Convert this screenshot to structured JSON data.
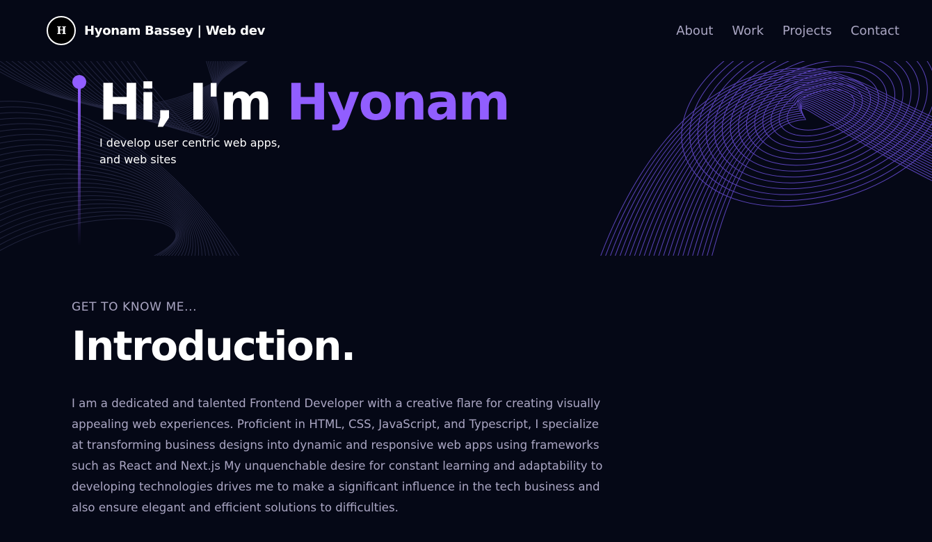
{
  "nav": {
    "logo_text": "H",
    "brand_name": "Hyonam Bassey",
    "brand_separator": "|",
    "brand_role": "Web dev",
    "links": [
      {
        "label": "About"
      },
      {
        "label": "Work"
      },
      {
        "label": "Projects"
      },
      {
        "label": "Contact"
      }
    ]
  },
  "hero": {
    "greeting": "Hi, I'm ",
    "name": "Hyonam",
    "subtitle_line1": "I develop user centric web apps,",
    "subtitle_line2": "and web sites"
  },
  "intro": {
    "eyebrow": "Get to know me...",
    "title": "Introduction.",
    "body": "I am a dedicated and talented Frontend Developer with a creative flare for creating visually appealing web experiences. Proficient in HTML, CSS, JavaScript, and Typescript, I specialize at transforming business designs into dynamic and responsive web apps using frameworks such as React and Next.js My unquenchable desire for constant learning and adaptability to developing technologies drives me to make a significant influence in the tech business and also ensure elegant and efficient solutions to difficulties."
  },
  "colors": {
    "background": "#050816",
    "accent": "#915eff",
    "secondary_text": "#aaa6c3",
    "primary_text": "#ffffff"
  }
}
